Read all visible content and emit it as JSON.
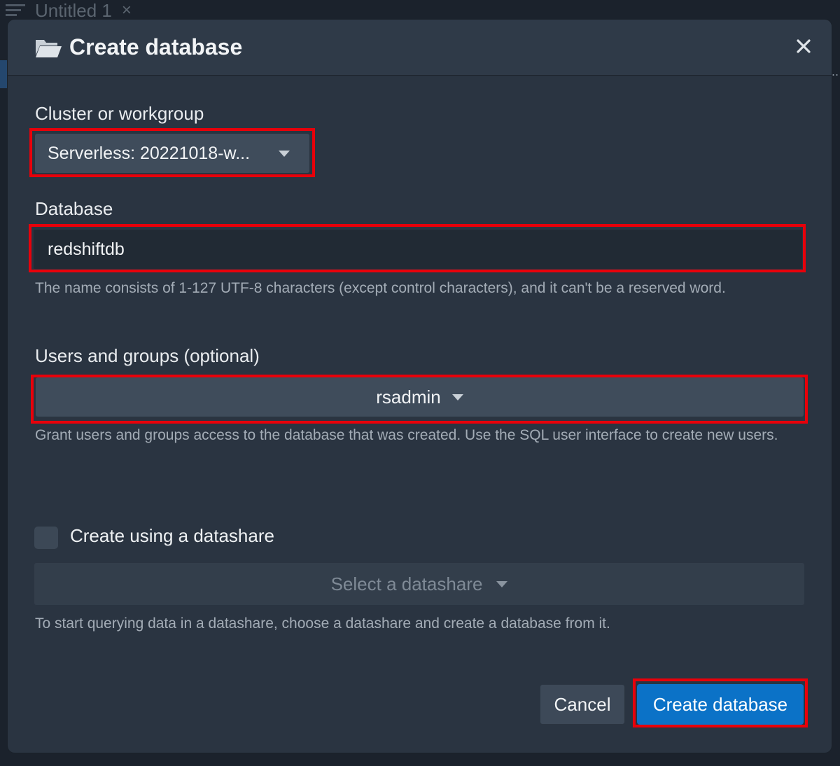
{
  "background": {
    "tab_title": "Untitled 1",
    "tab_close": "×",
    "ellipsis": "..."
  },
  "modal": {
    "title": "Create database",
    "icon": "folder-open-icon",
    "close_icon": "close-icon"
  },
  "cluster": {
    "label": "Cluster or workgroup",
    "selected": "Serverless: 20221018-w..."
  },
  "database": {
    "label": "Database",
    "value": "redshiftdb",
    "hint": "The name consists of 1-127 UTF-8 characters (except control characters), and it can't be a reserved word."
  },
  "users": {
    "label": "Users and groups (optional)",
    "selected": "rsadmin",
    "hint": "Grant users and groups access to the database that was created. Use the SQL user interface to create new users."
  },
  "datashare": {
    "checkbox_label": "Create using a datashare",
    "checked": false,
    "placeholder": "Select a datashare",
    "hint": "To start querying data in a datashare, choose a datashare and create a database from it."
  },
  "buttons": {
    "cancel": "Cancel",
    "create": "Create database"
  },
  "colors": {
    "modal_bg": "#2a3441",
    "select_bg": "#3f4c5b",
    "primary": "#0b72c7",
    "highlight": "#e8000a"
  }
}
